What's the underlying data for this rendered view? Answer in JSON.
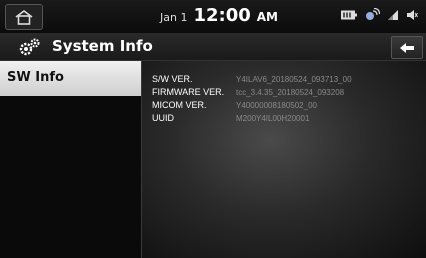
{
  "status_bar": {
    "date": "Jan 1",
    "time": "12:00",
    "ampm": "AM"
  },
  "header": {
    "title": "System Info"
  },
  "sidebar": {
    "items": [
      {
        "label": "SW Info",
        "selected": true
      }
    ]
  },
  "info": {
    "rows": [
      {
        "label": "S/W VER.",
        "value": "Y4ILAV6_20180524_093713_00"
      },
      {
        "label": "FIRMWARE VER.",
        "value": "tcc_3.4.35_20180524_093208"
      },
      {
        "label": "MICOM VER.",
        "value": "Y40000008180502_00"
      },
      {
        "label": "UUID",
        "value": "M200Y4IL00H20001"
      }
    ]
  },
  "colors": {
    "selected_item_bg": "#e6e6e6",
    "value_text": "#8a8a8a"
  }
}
